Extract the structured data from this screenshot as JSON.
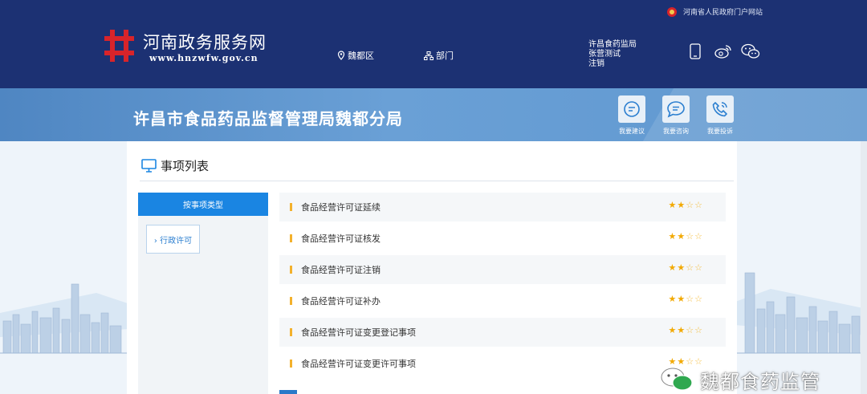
{
  "header": {
    "gov_portal_label": "河南省人民政府门户网站",
    "site_name": "河南政务服务网",
    "site_url": "www.hnzwfw.gov.cn",
    "nav": {
      "location_label": "魏都区",
      "department_label": "部门"
    },
    "user": {
      "org": "许昌食药监局",
      "name": "张营测试",
      "logout": "注销"
    }
  },
  "banner": {
    "title": "许昌市食品药品监督管理局魏都分局",
    "services": [
      {
        "label": "我要建议",
        "icon": "chat-icon"
      },
      {
        "label": "我要咨询",
        "icon": "consult-icon"
      },
      {
        "label": "我要投诉",
        "icon": "phone-icon"
      }
    ]
  },
  "panel": {
    "title": "事项列表",
    "filter_tab": "按事项类型",
    "filter_option": "› 行政许可"
  },
  "items": [
    {
      "name": "食品经营许可证延续",
      "stars": 2,
      "max_stars": 4
    },
    {
      "name": "食品经营许可证核发",
      "stars": 2,
      "max_stars": 4
    },
    {
      "name": "食品经营许可证注销",
      "stars": 2,
      "max_stars": 4
    },
    {
      "name": "食品经营许可证补办",
      "stars": 2,
      "max_stars": 4
    },
    {
      "name": "食品经营许可证变更登记事项",
      "stars": 2,
      "max_stars": 4
    },
    {
      "name": "食品经营许可证变更许可事项",
      "stars": 2,
      "max_stars": 4
    }
  ],
  "watermark": "魏都食药监管",
  "colors": {
    "header_bg": "#1c3173",
    "banner_bg": "#5f97cf",
    "accent_blue": "#1a85e2",
    "star_yellow": "#f2a900",
    "logo_red": "#d8242a"
  }
}
